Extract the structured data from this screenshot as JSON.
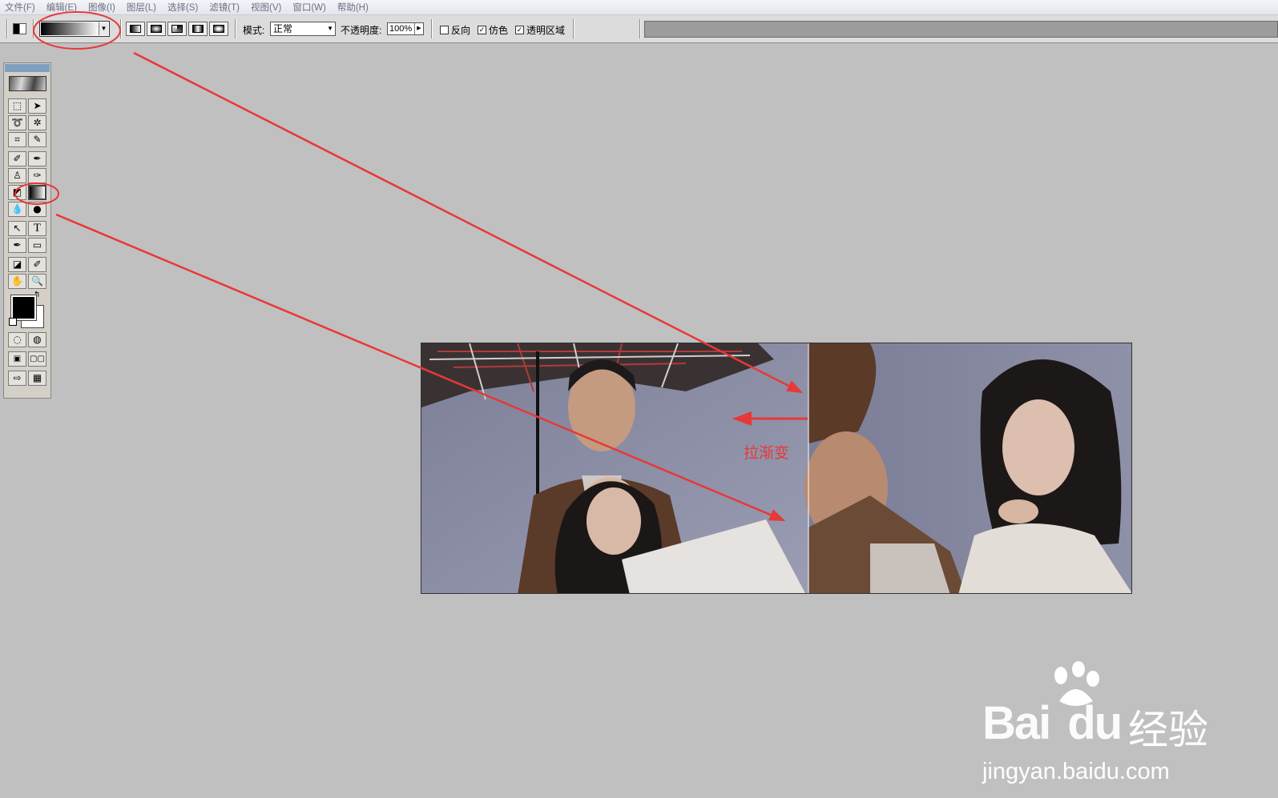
{
  "menubar": {
    "items": [
      "文件(F)",
      "编辑(E)",
      "图像(I)",
      "图层(L)",
      "选择(S)",
      "滤镜(T)",
      "视图(V)",
      "窗口(W)",
      "帮助(H)"
    ]
  },
  "options": {
    "mode_label": "模式:",
    "mode_value": "正常",
    "opacity_label": "不透明度:",
    "opacity_value": "100%",
    "reverse_label": "反向",
    "dither_label": "仿色",
    "transparency_label": "透明区域",
    "reverse_checked": false,
    "dither_checked": true,
    "transparency_checked": true
  },
  "annotation": {
    "label": "拉渐变",
    "color": "#e83838"
  },
  "watermark": {
    "brand": "Bai",
    "brand_du": "du",
    "brand_cn": "经验",
    "url": "jingyan.baidu.com"
  },
  "colors": {
    "foreground": "#000000",
    "background": "#ffffff",
    "workspace": "#c0c0c0"
  }
}
